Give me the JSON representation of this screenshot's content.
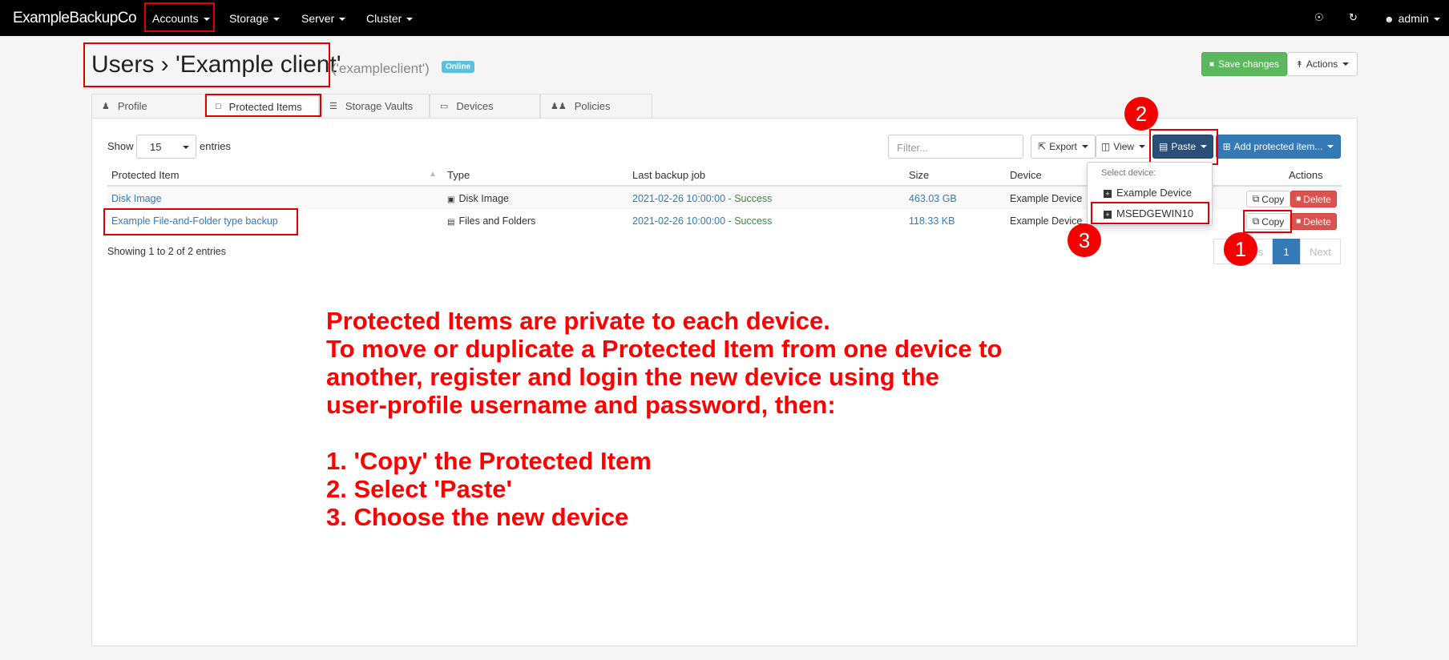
{
  "navbar": {
    "brand": "ExampleBackupCo",
    "menus": [
      "Accounts",
      "Storage",
      "Server",
      "Cluster"
    ],
    "user": "admin",
    "globe_icon": "globe-icon",
    "refresh_icon": "refresh-icon",
    "user_icon": "user-circle-icon"
  },
  "header": {
    "title": "Users › 'Example client'",
    "subtitle": "('exampleclient')",
    "status_badge": "Online",
    "save_button": "Save changes",
    "actions_button": "Actions"
  },
  "tabs": [
    {
      "label": "Profile",
      "icon": "user-icon"
    },
    {
      "label": "Protected Items",
      "icon": "folder-icon",
      "active": true
    },
    {
      "label": "Storage Vaults",
      "icon": "database-icon"
    },
    {
      "label": "Devices",
      "icon": "device-icon"
    },
    {
      "label": "Policies",
      "icon": "users-icon"
    }
  ],
  "table_controls": {
    "show_label": "Show",
    "page_length": "15",
    "entries_label": "entries",
    "filter_placeholder": "Filter...",
    "export_button": "Export",
    "view_button": "View",
    "paste_button": "Paste",
    "add_button": "Add protected item..."
  },
  "table": {
    "columns": [
      "Protected Item",
      "Type",
      "Last backup job",
      "Size",
      "Device",
      "Actions"
    ],
    "rows": [
      {
        "name": "Disk Image",
        "type": "Disk Image",
        "job_time": "2021-02-26 10:00:00",
        "job_sep": " - ",
        "job_status": "Success",
        "size": "463.03 GB",
        "device": "Example Device",
        "copy": "Copy",
        "delete": "Delete"
      },
      {
        "name": "Example File-and-Folder type backup",
        "type": "Files and Folders",
        "job_time": "2021-02-26 10:00:00",
        "job_sep": " - ",
        "job_status": "Success",
        "size": "118.33 KB",
        "device": "Example Device",
        "copy": "Copy",
        "delete": "Delete"
      }
    ],
    "info": "Showing 1 to 2 of 2 entries"
  },
  "pagination": {
    "previous": "Previous",
    "current": "1",
    "next": "Next"
  },
  "paste_menu": {
    "header": "Select device:",
    "items": [
      "Example Device",
      "MSEDGEWIN10"
    ]
  },
  "callouts": [
    "1",
    "2",
    "3"
  ],
  "instructions": [
    "Protected Items are private to each device.",
    "To move or duplicate a Protected Item from one device to",
    "another, register and login the new device using the",
    "user-profile username and password, then:",
    "",
    "1. 'Copy' the Protected Item",
    "2. Select 'Paste'",
    "3. Choose the new device"
  ],
  "colors": {
    "annotation": "#e00000",
    "primary": "#337ab7",
    "success": "#5cb85c",
    "danger": "#d9534f",
    "badge": "#5bc0de"
  }
}
